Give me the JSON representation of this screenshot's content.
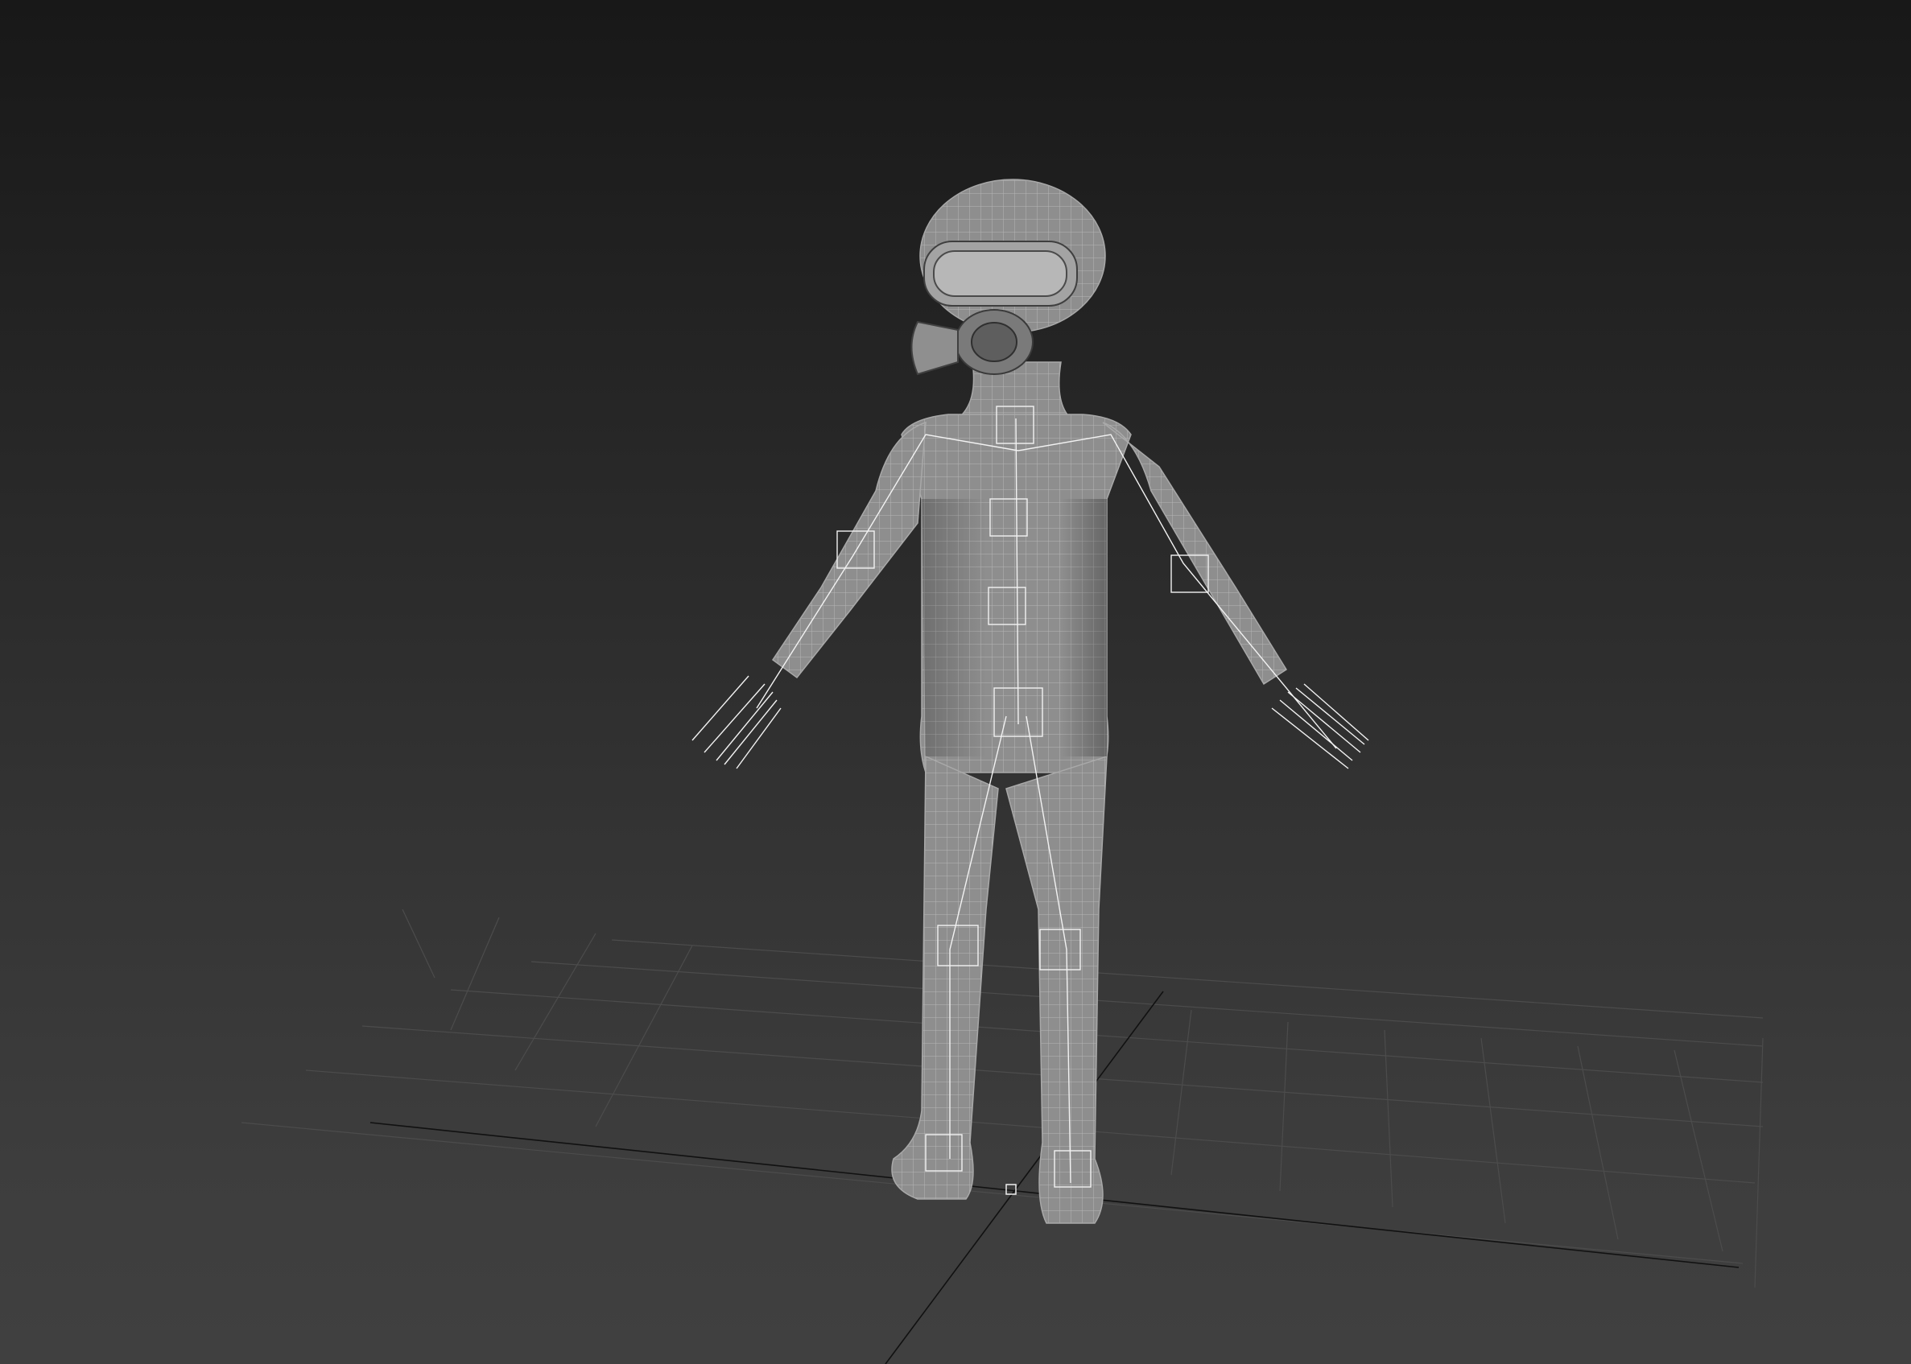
{
  "viewport": {
    "background_top": "#181818",
    "background_bottom": "#404040",
    "mesh_fill": "#8c8c8c",
    "wire_color": "#b4b4b4",
    "bone_color": "#f2f2f2",
    "grid_color": "#4c4c4c",
    "axis_color": "#111111",
    "display_mode": "wireframe-over-shaded",
    "grid_visible": true
  },
  "model": {
    "pose": "a-pose",
    "accessory": "gas-mask-with-goggles"
  }
}
